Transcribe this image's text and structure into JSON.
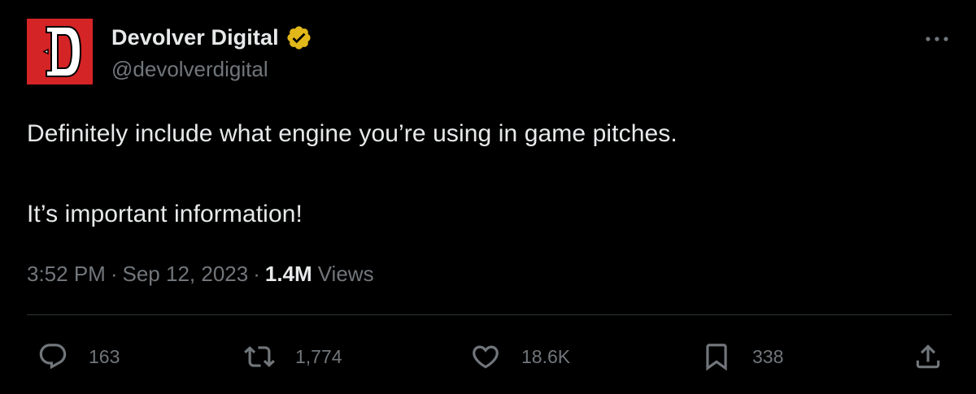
{
  "author": {
    "display_name": "Devolver Digital",
    "handle": "@devolverdigital",
    "verified_badge_color": "#e2b719",
    "avatar_color": "#d42426",
    "avatar_icon": "devolver-logo"
  },
  "tweet": {
    "text_line_1": "Definitely include what engine you’re using in game pitches.",
    "text_line_2": "It’s important information!"
  },
  "meta": {
    "time": "3:52 PM",
    "separator": "·",
    "date": "Sep 12, 2023",
    "views_count": "1.4M",
    "views_label": "Views"
  },
  "actions": {
    "reply_count": "163",
    "retweet_count": "1,774",
    "like_count": "18.6K",
    "bookmark_count": "338"
  },
  "icons": {
    "more": "more-icon",
    "reply": "reply-icon",
    "retweet": "retweet-icon",
    "like": "heart-icon",
    "bookmark": "bookmark-icon",
    "share": "share-icon"
  }
}
